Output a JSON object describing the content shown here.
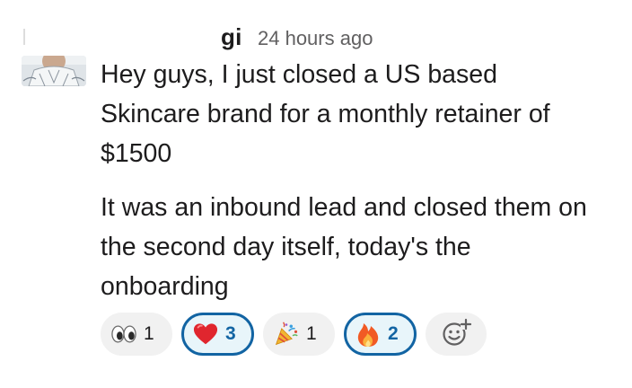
{
  "message": {
    "sender_name": "gi",
    "timestamp": "24 hours ago",
    "paragraphs": [
      "Hey guys, I just closed a US based\nSkincare brand for a monthly retainer of\n$1500",
      "It was an inbound lead and closed them on\nthe second day itself, today's the\nonboarding"
    ]
  },
  "reactions": [
    {
      "emoji": "eyes-icon",
      "count": "1",
      "active": false
    },
    {
      "emoji": "red-heart-icon",
      "count": "3",
      "active": true
    },
    {
      "emoji": "party-popper-icon",
      "count": "1",
      "active": false
    },
    {
      "emoji": "fire-icon",
      "count": "2",
      "active": true
    }
  ],
  "add_reaction": {
    "icon": "add-reaction-icon"
  },
  "colors": {
    "accent": "#1264a3",
    "active_reaction_bg": "#e8f5fa",
    "reaction_bg": "#f1f1f1",
    "text": "#1d1c1d",
    "muted": "#616061"
  }
}
